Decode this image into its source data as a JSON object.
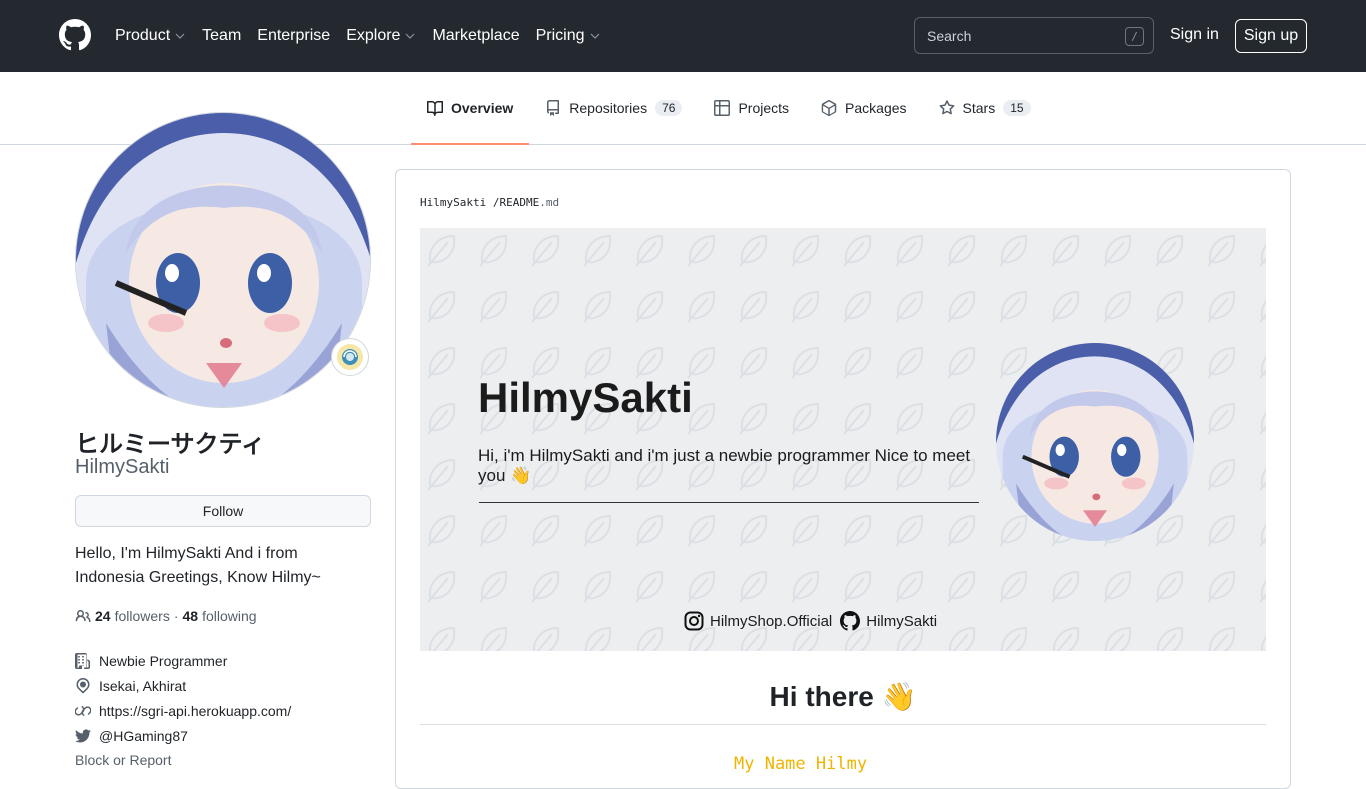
{
  "header": {
    "nav": [
      {
        "label": "Product",
        "dropdown": true
      },
      {
        "label": "Team",
        "dropdown": false
      },
      {
        "label": "Enterprise",
        "dropdown": false
      },
      {
        "label": "Explore",
        "dropdown": true
      },
      {
        "label": "Marketplace",
        "dropdown": false
      },
      {
        "label": "Pricing",
        "dropdown": true
      }
    ],
    "search_placeholder": "Search",
    "search_shortcut": "/",
    "sign_in": "Sign in",
    "sign_up": "Sign up"
  },
  "tabs": [
    {
      "label": "Overview",
      "icon": "book-icon",
      "active": true,
      "count": ""
    },
    {
      "label": "Repositories",
      "icon": "repo-icon",
      "active": false,
      "count": "76"
    },
    {
      "label": "Projects",
      "icon": "table-icon",
      "active": false,
      "count": ""
    },
    {
      "label": "Packages",
      "icon": "package-icon",
      "active": false,
      "count": ""
    },
    {
      "label": "Stars",
      "icon": "star-icon",
      "active": false,
      "count": "15"
    }
  ],
  "profile": {
    "full_name": "ヒルミーサクティ",
    "username": "HilmySakti",
    "follow_label": "Follow",
    "bio": "Hello, I'm HilmySakti And i from Indonesia Greetings, Know Hilmy~",
    "followers_count": "24",
    "followers_label": "followers",
    "separator": "·",
    "following_count": "48",
    "following_label": "following",
    "details": {
      "company": "Newbie Programmer",
      "location": "Isekai, Akhirat",
      "website": "https://sgri-api.herokuapp.com/",
      "twitter": "@HGaming87"
    },
    "block_report": "Block or Report"
  },
  "readme": {
    "breadcrumb_user": "HilmySakti",
    "breadcrumb_sep": "/",
    "breadcrumb_file": "README",
    "breadcrumb_ext": ".md",
    "banner": {
      "title": "HilmySakti",
      "subtitle": "Hi, i'm HilmySakti and i'm just a newbie programmer Nice to meet you 👋",
      "instagram": "HilmyShop.Official",
      "github": "HilmySakti"
    },
    "heading": "Hi there 👋",
    "typing_text": "My Name Hilmy"
  },
  "colors": {
    "header_bg": "#24292f",
    "active_tab_underline": "#fd8c73",
    "banner_bg": "#eceef0",
    "typing_text": "#f0b400"
  }
}
